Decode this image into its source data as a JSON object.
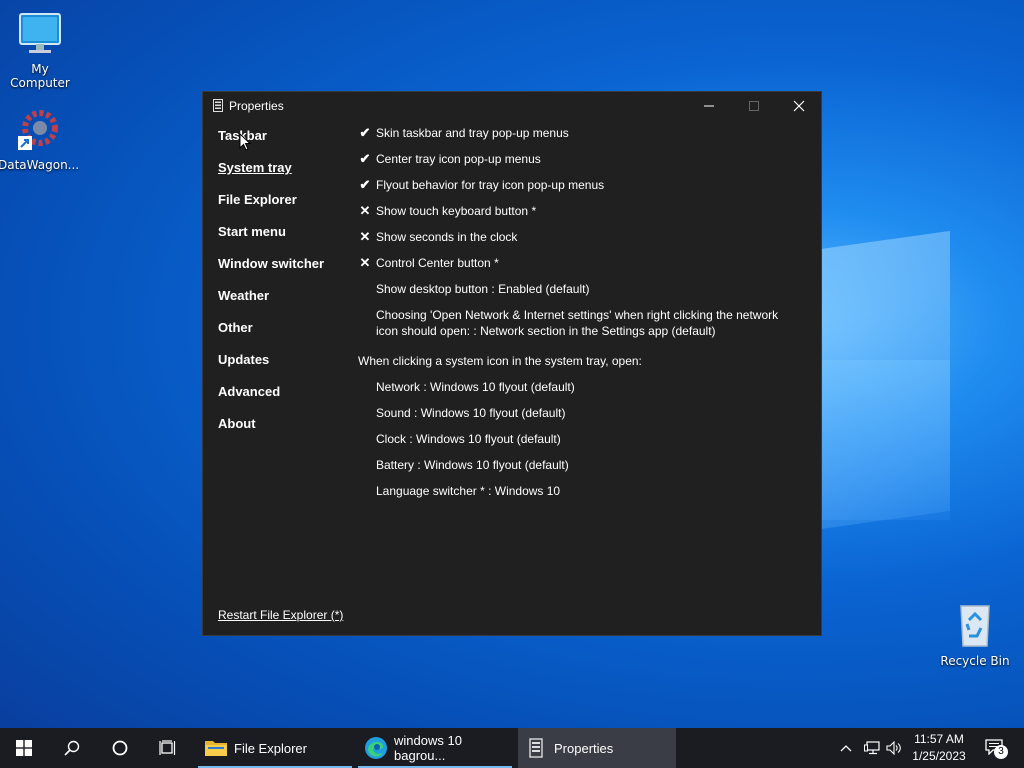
{
  "desktop": {
    "icons": [
      {
        "label": "My Computer"
      },
      {
        "label": "DataWagon..."
      },
      {
        "label": "Recycle Bin"
      }
    ]
  },
  "window": {
    "title": "Properties",
    "nav": [
      {
        "label": "Taskbar"
      },
      {
        "label": "System tray",
        "active": true
      },
      {
        "label": "File Explorer"
      },
      {
        "label": "Start menu"
      },
      {
        "label": "Window switcher"
      },
      {
        "label": "Weather"
      },
      {
        "label": "Other"
      },
      {
        "label": "Updates"
      },
      {
        "label": "Advanced"
      },
      {
        "label": "About"
      }
    ],
    "options": [
      {
        "mark": "✔",
        "label": "Skin taskbar and tray pop-up menus"
      },
      {
        "mark": "✔",
        "label": "Center tray icon pop-up menus"
      },
      {
        "mark": "✔",
        "label": "Flyout behavior for tray icon pop-up menus"
      },
      {
        "mark": "✕",
        "label": "Show touch keyboard button *"
      },
      {
        "mark": "✕",
        "label": "Show seconds in the clock"
      },
      {
        "mark": "✕",
        "label": "Control Center button *"
      },
      {
        "mark": "",
        "label": "Show desktop button : Enabled (default)"
      },
      {
        "mark": "",
        "label": "Choosing 'Open Network & Internet settings' when right clicking the network icon should open: : Network section in the Settings app (default)"
      }
    ],
    "section_heading": "When clicking a system icon in the system tray, open:",
    "sub_options": [
      {
        "label": "Network : Windows 10 flyout (default)"
      },
      {
        "label": "Sound : Windows 10 flyout (default)"
      },
      {
        "label": "Clock : Windows 10 flyout (default)"
      },
      {
        "label": "Battery : Windows 10 flyout (default)"
      },
      {
        "label": "Language switcher * : Windows 10"
      }
    ],
    "restart_link": "Restart File Explorer (*)"
  },
  "taskbar": {
    "apps": [
      {
        "label": "File Explorer"
      },
      {
        "label": "windows 10 bagrou..."
      },
      {
        "label": "Properties"
      }
    ],
    "clock_time": "11:57 AM",
    "clock_date": "1/25/2023",
    "notification_count": "3"
  },
  "colors": {
    "window_bg": "#202020",
    "taskbar_bg": "#1a1c22",
    "accent_underline": "#76b9ed"
  }
}
